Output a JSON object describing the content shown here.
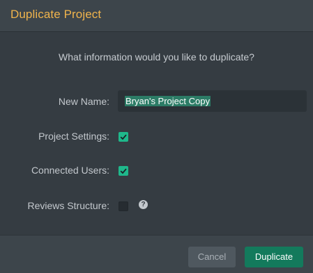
{
  "dialog": {
    "title": "Duplicate Project",
    "prompt": "What information would you like to duplicate?"
  },
  "form": {
    "name_label": "New Name:",
    "name_value": "Bryan's Project Copy",
    "settings_label": "Project Settings:",
    "settings_checked": true,
    "users_label": "Connected Users:",
    "users_checked": true,
    "reviews_label": "Reviews Structure:",
    "reviews_checked": false,
    "help_glyph": "?"
  },
  "footer": {
    "cancel_label": "Cancel",
    "duplicate_label": "Duplicate"
  },
  "colors": {
    "title": "#f0b44c",
    "accent": "#1fb88b",
    "primary_button": "#137a5c",
    "background": "#353c42"
  },
  "icons": {
    "checkmark": "check-icon",
    "help": "help-icon"
  }
}
